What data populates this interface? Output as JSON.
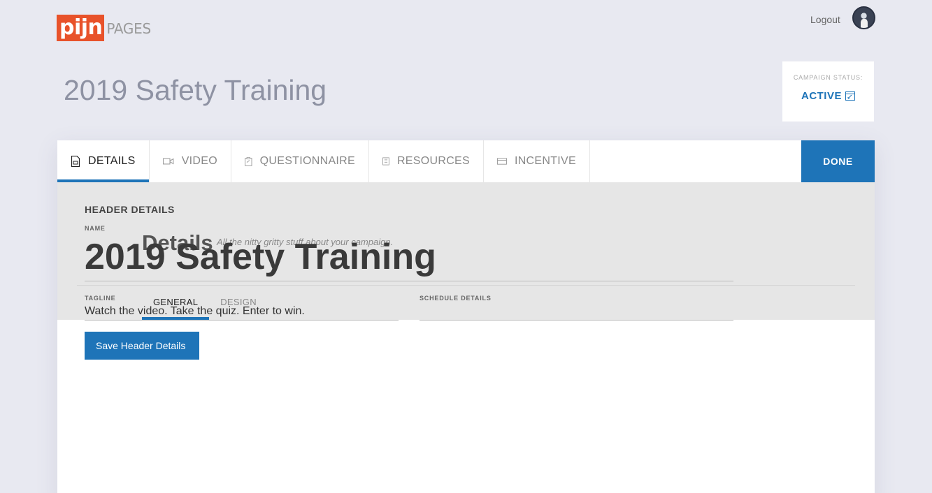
{
  "brand": {
    "logo_text": "pijn",
    "logo_suffix": "PAGES"
  },
  "header": {
    "logout_label": "Logout"
  },
  "page": {
    "title": "2019 Safety Training"
  },
  "campaign_status": {
    "label": "CAMPAIGN STATUS:",
    "value": "ACTIVE"
  },
  "tabs": [
    {
      "label": "DETAILS",
      "icon": "document-icon",
      "active": true
    },
    {
      "label": "VIDEO",
      "icon": "video-camera-icon",
      "active": false
    },
    {
      "label": "QUESTIONNAIRE",
      "icon": "clipboard-icon",
      "active": false
    },
    {
      "label": "RESOURCES",
      "icon": "book-icon",
      "active": false
    },
    {
      "label": "INCENTIVE",
      "icon": "card-icon",
      "active": false
    }
  ],
  "done_label": "DONE",
  "section": {
    "title": "Details",
    "subtitle": "All the nitty gritty stuff about your campaign."
  },
  "subtabs": [
    {
      "label": "GENERAL",
      "active": true
    },
    {
      "label": "DESIGN",
      "active": false
    }
  ],
  "form": {
    "heading": "HEADER DETAILS",
    "name_label": "NAME",
    "name_value": "2019 Safety Training",
    "tagline_label": "TAGLINE",
    "tagline_value": "Watch the video. Take the quiz. Enter to win.",
    "schedule_label": "SCHEDULE DETAILS",
    "schedule_value": "",
    "save_label": "Save Header Details"
  },
  "colors": {
    "accent": "#1e74b8",
    "brand": "#e8522a",
    "background": "#e8e9f1"
  }
}
